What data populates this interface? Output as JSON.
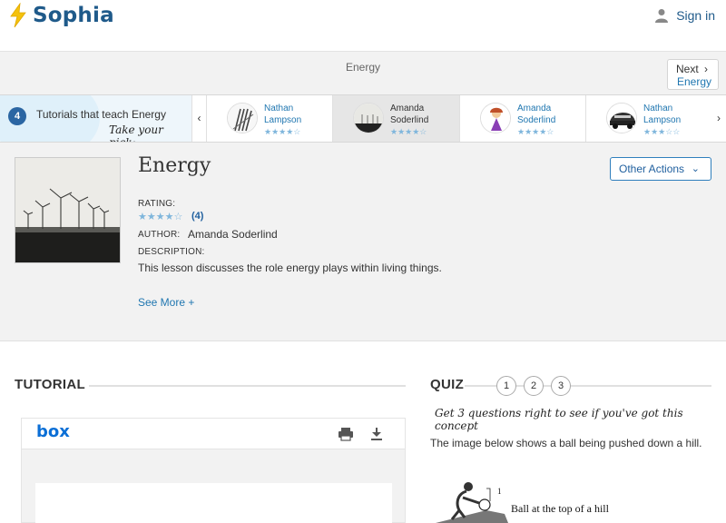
{
  "header": {
    "brand": "Sophia",
    "sign_in": "Sign in"
  },
  "breadcrumb": "Energy",
  "next": {
    "label": "Next",
    "target": "Energy"
  },
  "tutorials": {
    "count": "4",
    "heading": "Tutorials that teach Energy",
    "pick": "Take your pick:",
    "cards": [
      {
        "author_line1": "Nathan",
        "author_line2": "Lampson",
        "stars": "★★★★☆",
        "rating": 4,
        "selected": false
      },
      {
        "author_line1": "Amanda",
        "author_line2": "Soderlind",
        "stars": "★★★★☆",
        "rating": 4,
        "selected": true
      },
      {
        "author_line1": "Amanda",
        "author_line2": "Soderlind",
        "stars": "★★★★☆",
        "rating": 3.5,
        "selected": false
      },
      {
        "author_line1": "Nathan",
        "author_line2": "Lampson",
        "stars": "★★★☆☆",
        "rating": 3,
        "selected": false
      }
    ]
  },
  "lesson": {
    "title": "Energy",
    "other_actions": "Other Actions",
    "rating_label": "RATING:",
    "rating_stars": "★★★★☆",
    "rating_count": "(4)",
    "author_label": "AUTHOR:",
    "author": "Amanda Soderlind",
    "description_label": "DESCRIPTION:",
    "description": "This lesson discusses the role energy plays within living things.",
    "see_more": "See More +"
  },
  "tutorial_section": {
    "heading": "TUTORIAL",
    "viewer_brand": "box"
  },
  "quiz": {
    "heading": "QUIZ",
    "numbers": [
      "1",
      "2",
      "3"
    ],
    "tagline": "Get 3 questions right to see if you've got this concept",
    "question": "The image below shows a ball being pushed down a hill.",
    "diagram_number": "1",
    "diagram_label": "Ball at the top of a hill"
  },
  "colors": {
    "brand_blue": "#1f5a8a",
    "link_blue": "#1f76b0",
    "star_blue": "#7fb6dc",
    "logo_yellow": "#f4c20d",
    "box_blue": "#0b6fd6"
  },
  "icons": [
    "sophia-logo-icon",
    "person-icon",
    "chevron-right-icon",
    "chevron-left-icon",
    "chevron-down-icon",
    "print-icon",
    "download-icon"
  ]
}
